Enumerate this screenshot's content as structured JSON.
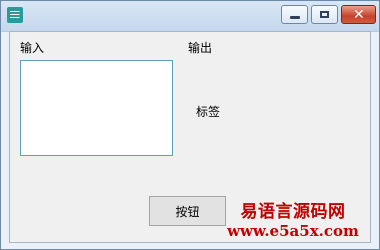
{
  "window": {
    "buttons": {
      "minimize_icon": "minimize-icon",
      "maximize_icon": "maximize-icon",
      "close_icon": "close-icon"
    }
  },
  "form": {
    "input_label": "输入",
    "output_label": "输出",
    "tag_label": "标签",
    "button_label": "按钮",
    "input_value": ""
  },
  "watermark": {
    "title": "易语言源码网",
    "url": "www.e5a5x.com"
  },
  "colors": {
    "close_button": "#c6422a",
    "watermark": "#c20000"
  }
}
